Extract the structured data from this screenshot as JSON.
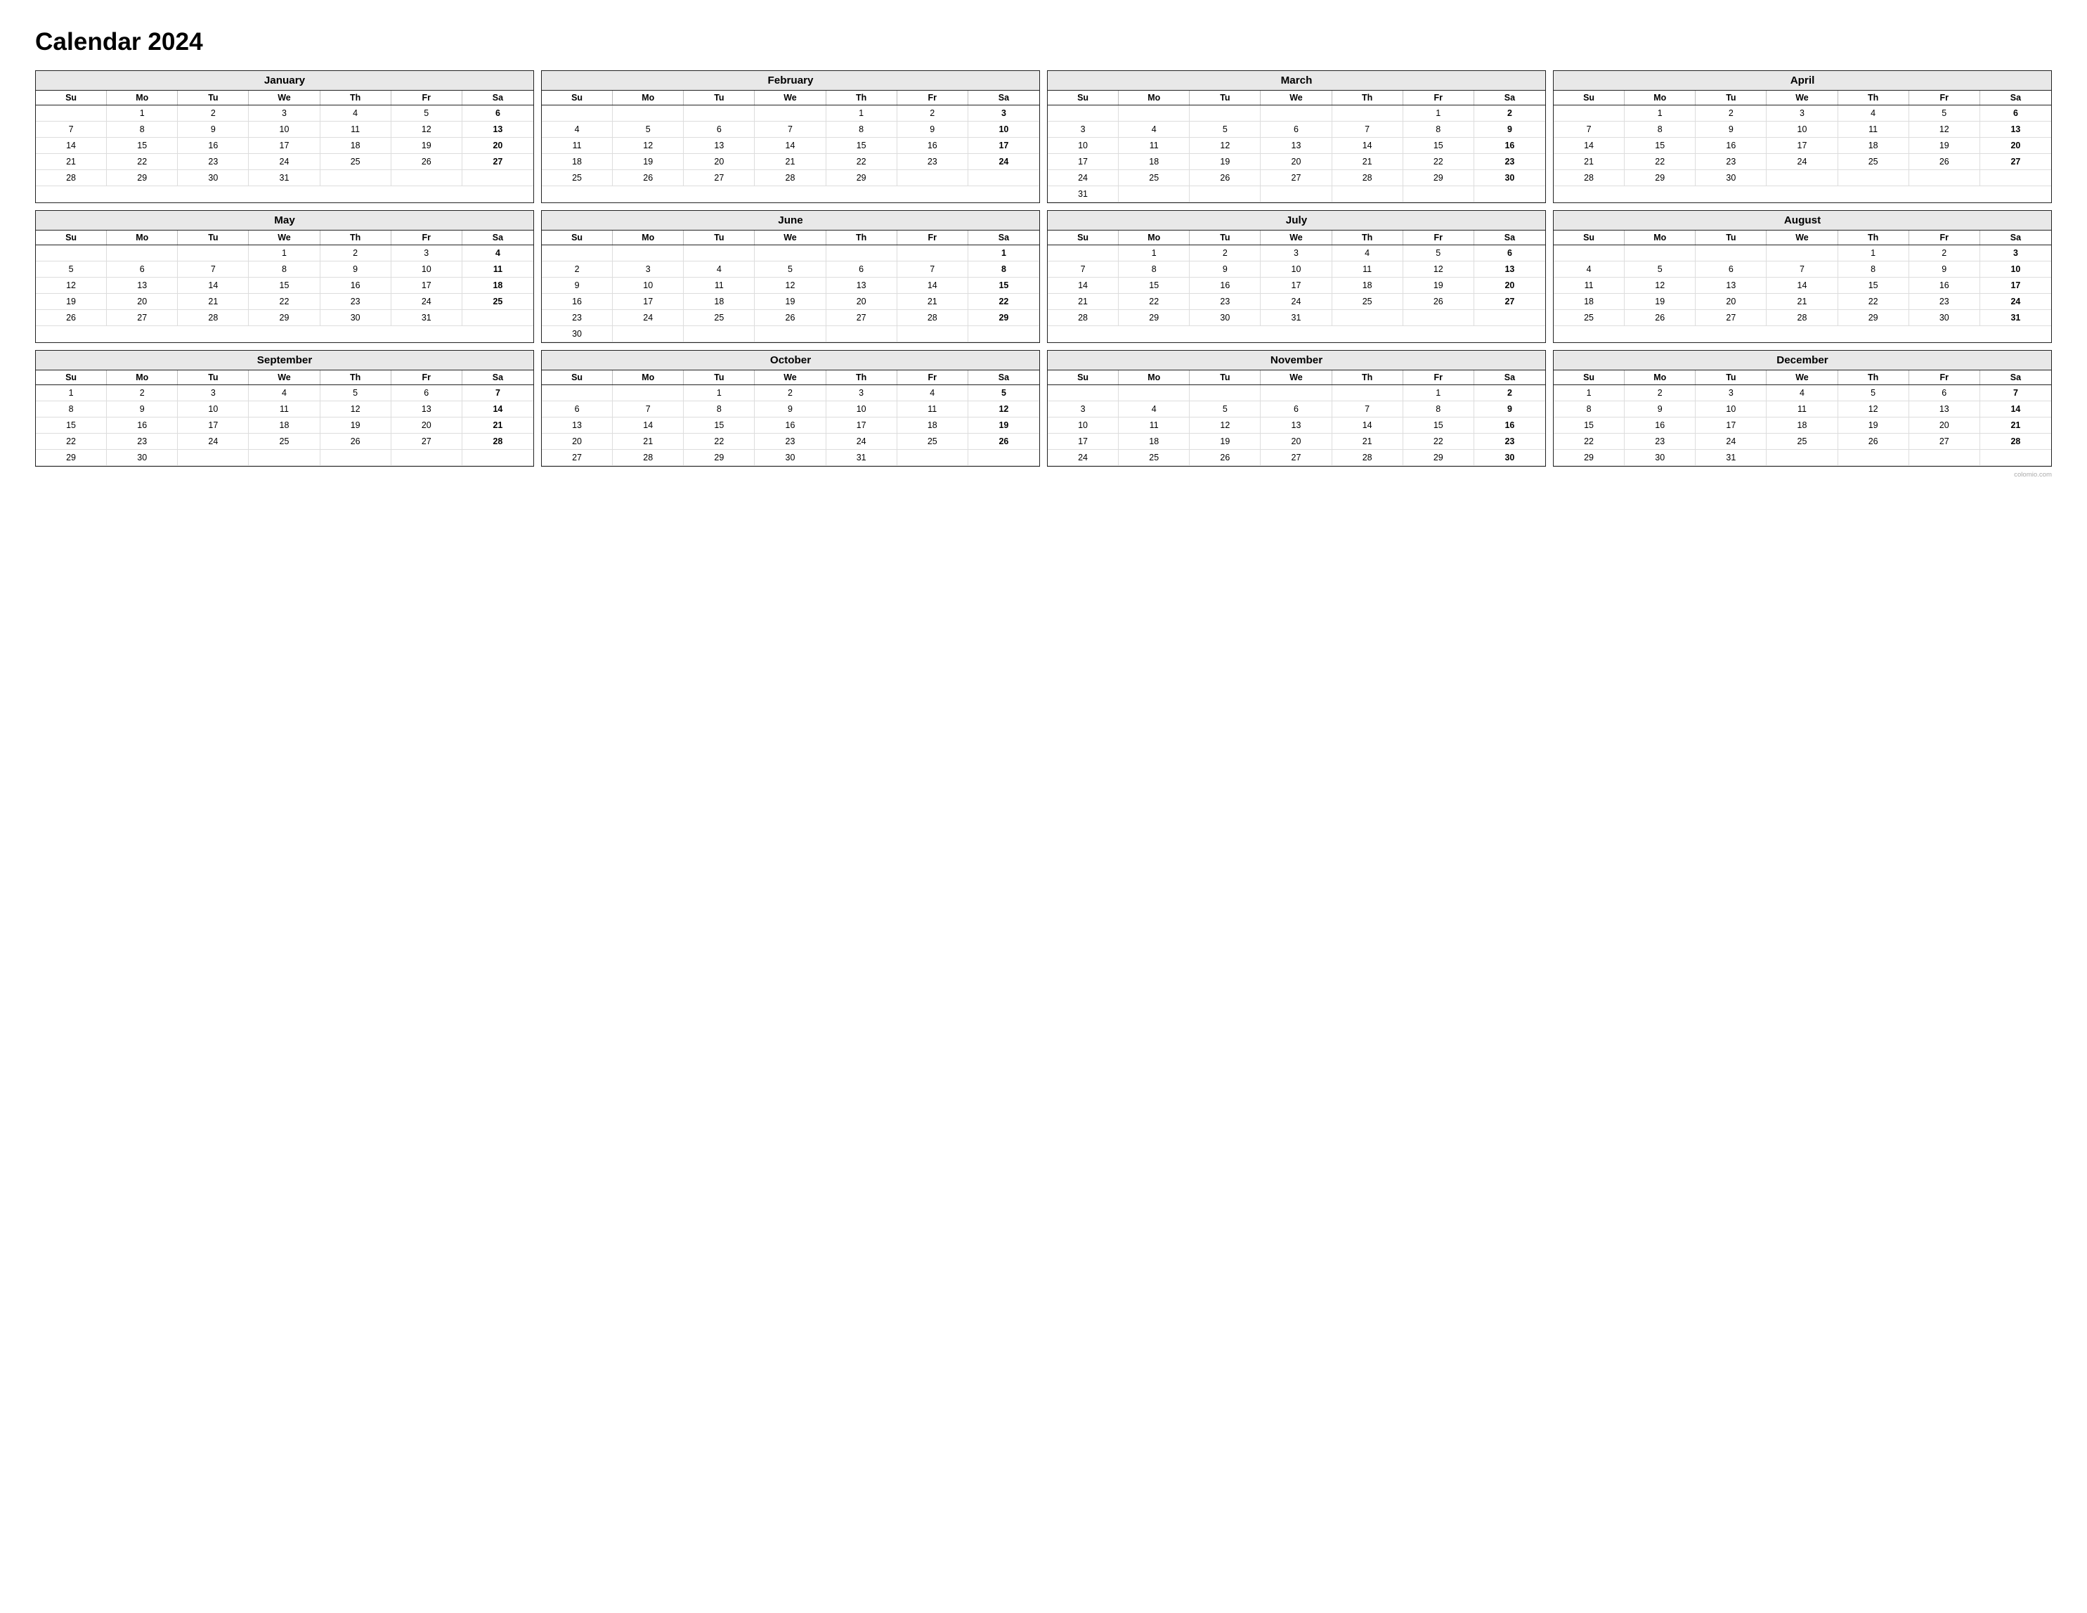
{
  "title": "Calendar 2024",
  "watermark": "colomio.com",
  "months": [
    {
      "name": "January",
      "days": [
        "",
        "1",
        "2",
        "3",
        "4",
        "5",
        "6",
        "7",
        "8",
        "9",
        "10",
        "11",
        "12",
        "13",
        "14",
        "15",
        "16",
        "17",
        "18",
        "19",
        "20",
        "21",
        "22",
        "23",
        "24",
        "25",
        "26",
        "27",
        "28",
        "29",
        "30",
        "31",
        "",
        "",
        ""
      ],
      "bold_cols": [
        6
      ]
    },
    {
      "name": "February",
      "days": [
        "",
        "",
        "",
        "",
        "1",
        "2",
        "3",
        "4",
        "5",
        "6",
        "7",
        "8",
        "9",
        "10",
        "11",
        "12",
        "13",
        "14",
        "15",
        "16",
        "17",
        "18",
        "19",
        "20",
        "21",
        "22",
        "23",
        "24",
        "25",
        "26",
        "27",
        "28",
        "29",
        "",
        ""
      ],
      "bold_cols": [
        6
      ]
    },
    {
      "name": "March",
      "days": [
        "",
        "",
        "",
        "",
        "",
        "1",
        "2",
        "3",
        "4",
        "5",
        "6",
        "7",
        "8",
        "9",
        "10",
        "11",
        "12",
        "13",
        "14",
        "15",
        "16",
        "17",
        "18",
        "19",
        "20",
        "21",
        "22",
        "23",
        "24",
        "25",
        "26",
        "27",
        "28",
        "29",
        "30",
        "31",
        "",
        "",
        "",
        "",
        "",
        ""
      ],
      "bold_cols": [
        6
      ]
    },
    {
      "name": "April",
      "days": [
        "",
        "1",
        "2",
        "3",
        "4",
        "5",
        "6",
        "7",
        "8",
        "9",
        "10",
        "11",
        "12",
        "13",
        "14",
        "15",
        "16",
        "17",
        "18",
        "19",
        "20",
        "21",
        "22",
        "23",
        "24",
        "25",
        "26",
        "27",
        "28",
        "29",
        "30",
        "",
        "",
        "",
        ""
      ],
      "bold_cols": [
        6
      ]
    },
    {
      "name": "May",
      "days": [
        "",
        "",
        "",
        "1",
        "2",
        "3",
        "4",
        "5",
        "6",
        "7",
        "8",
        "9",
        "10",
        "11",
        "12",
        "13",
        "14",
        "15",
        "16",
        "17",
        "18",
        "19",
        "20",
        "21",
        "22",
        "23",
        "24",
        "25",
        "26",
        "27",
        "28",
        "29",
        "30",
        "31",
        ""
      ],
      "bold_cols": [
        6
      ]
    },
    {
      "name": "June",
      "days": [
        "",
        "",
        "",
        "",
        "",
        "",
        "1",
        "2",
        "3",
        "4",
        "5",
        "6",
        "7",
        "8",
        "9",
        "10",
        "11",
        "12",
        "13",
        "14",
        "15",
        "16",
        "17",
        "18",
        "19",
        "20",
        "21",
        "22",
        "23",
        "24",
        "25",
        "26",
        "27",
        "28",
        "29",
        "30",
        "",
        "",
        "",
        "",
        "",
        ""
      ],
      "bold_cols": [
        6
      ]
    },
    {
      "name": "July",
      "days": [
        "",
        "1",
        "2",
        "3",
        "4",
        "5",
        "6",
        "7",
        "8",
        "9",
        "10",
        "11",
        "12",
        "13",
        "14",
        "15",
        "16",
        "17",
        "18",
        "19",
        "20",
        "21",
        "22",
        "23",
        "24",
        "25",
        "26",
        "27",
        "28",
        "29",
        "30",
        "31",
        "",
        "",
        ""
      ],
      "bold_cols": [
        6
      ]
    },
    {
      "name": "August",
      "days": [
        "",
        "",
        "",
        "",
        "1",
        "2",
        "3",
        "4",
        "5",
        "6",
        "7",
        "8",
        "9",
        "10",
        "11",
        "12",
        "13",
        "14",
        "15",
        "16",
        "17",
        "18",
        "19",
        "20",
        "21",
        "22",
        "23",
        "24",
        "25",
        "26",
        "27",
        "28",
        "29",
        "30",
        "31"
      ],
      "bold_cols": [
        6
      ]
    },
    {
      "name": "September",
      "days": [
        "1",
        "2",
        "3",
        "4",
        "5",
        "6",
        "7",
        "8",
        "9",
        "10",
        "11",
        "12",
        "13",
        "14",
        "15",
        "16",
        "17",
        "18",
        "19",
        "20",
        "21",
        "22",
        "23",
        "24",
        "25",
        "26",
        "27",
        "28",
        "29",
        "30",
        "",
        "",
        "",
        "",
        ""
      ],
      "bold_cols": [
        6
      ]
    },
    {
      "name": "October",
      "days": [
        "",
        "",
        "1",
        "2",
        "3",
        "4",
        "5",
        "6",
        "7",
        "8",
        "9",
        "10",
        "11",
        "12",
        "13",
        "14",
        "15",
        "16",
        "17",
        "18",
        "19",
        "20",
        "21",
        "22",
        "23",
        "24",
        "25",
        "26",
        "27",
        "28",
        "29",
        "30",
        "31",
        "",
        ""
      ],
      "bold_cols": [
        6
      ]
    },
    {
      "name": "November",
      "days": [
        "",
        "",
        "",
        "",
        "",
        "1",
        "2",
        "3",
        "4",
        "5",
        "6",
        "7",
        "8",
        "9",
        "10",
        "11",
        "12",
        "13",
        "14",
        "15",
        "16",
        "17",
        "18",
        "19",
        "20",
        "21",
        "22",
        "23",
        "24",
        "25",
        "26",
        "27",
        "28",
        "29",
        "30"
      ],
      "bold_cols": [
        6
      ]
    },
    {
      "name": "December",
      "days": [
        "1",
        "2",
        "3",
        "4",
        "5",
        "6",
        "7",
        "8",
        "9",
        "10",
        "11",
        "12",
        "13",
        "14",
        "15",
        "16",
        "17",
        "18",
        "19",
        "20",
        "21",
        "22",
        "23",
        "24",
        "25",
        "26",
        "27",
        "28",
        "29",
        "30",
        "31",
        "",
        "",
        "",
        ""
      ],
      "bold_cols": [
        6
      ]
    }
  ],
  "day_headers": [
    "Su",
    "Mo",
    "Tu",
    "We",
    "Th",
    "Fr",
    "Sa"
  ]
}
